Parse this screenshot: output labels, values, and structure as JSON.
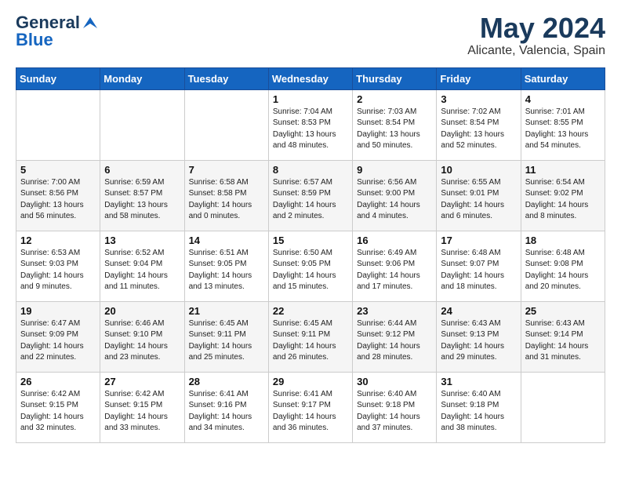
{
  "logo": {
    "line1": "General",
    "line2": "Blue",
    "bird_symbol": "▲"
  },
  "header": {
    "month_title": "May 2024",
    "location": "Alicante, Valencia, Spain"
  },
  "weekdays": [
    "Sunday",
    "Monday",
    "Tuesday",
    "Wednesday",
    "Thursday",
    "Friday",
    "Saturday"
  ],
  "weeks": [
    [
      {
        "day": "",
        "info": ""
      },
      {
        "day": "",
        "info": ""
      },
      {
        "day": "",
        "info": ""
      },
      {
        "day": "1",
        "info": "Sunrise: 7:04 AM\nSunset: 8:53 PM\nDaylight: 13 hours\nand 48 minutes."
      },
      {
        "day": "2",
        "info": "Sunrise: 7:03 AM\nSunset: 8:54 PM\nDaylight: 13 hours\nand 50 minutes."
      },
      {
        "day": "3",
        "info": "Sunrise: 7:02 AM\nSunset: 8:54 PM\nDaylight: 13 hours\nand 52 minutes."
      },
      {
        "day": "4",
        "info": "Sunrise: 7:01 AM\nSunset: 8:55 PM\nDaylight: 13 hours\nand 54 minutes."
      }
    ],
    [
      {
        "day": "5",
        "info": "Sunrise: 7:00 AM\nSunset: 8:56 PM\nDaylight: 13 hours\nand 56 minutes."
      },
      {
        "day": "6",
        "info": "Sunrise: 6:59 AM\nSunset: 8:57 PM\nDaylight: 13 hours\nand 58 minutes."
      },
      {
        "day": "7",
        "info": "Sunrise: 6:58 AM\nSunset: 8:58 PM\nDaylight: 14 hours\nand 0 minutes."
      },
      {
        "day": "8",
        "info": "Sunrise: 6:57 AM\nSunset: 8:59 PM\nDaylight: 14 hours\nand 2 minutes."
      },
      {
        "day": "9",
        "info": "Sunrise: 6:56 AM\nSunset: 9:00 PM\nDaylight: 14 hours\nand 4 minutes."
      },
      {
        "day": "10",
        "info": "Sunrise: 6:55 AM\nSunset: 9:01 PM\nDaylight: 14 hours\nand 6 minutes."
      },
      {
        "day": "11",
        "info": "Sunrise: 6:54 AM\nSunset: 9:02 PM\nDaylight: 14 hours\nand 8 minutes."
      }
    ],
    [
      {
        "day": "12",
        "info": "Sunrise: 6:53 AM\nSunset: 9:03 PM\nDaylight: 14 hours\nand 9 minutes."
      },
      {
        "day": "13",
        "info": "Sunrise: 6:52 AM\nSunset: 9:04 PM\nDaylight: 14 hours\nand 11 minutes."
      },
      {
        "day": "14",
        "info": "Sunrise: 6:51 AM\nSunset: 9:05 PM\nDaylight: 14 hours\nand 13 minutes."
      },
      {
        "day": "15",
        "info": "Sunrise: 6:50 AM\nSunset: 9:05 PM\nDaylight: 14 hours\nand 15 minutes."
      },
      {
        "day": "16",
        "info": "Sunrise: 6:49 AM\nSunset: 9:06 PM\nDaylight: 14 hours\nand 17 minutes."
      },
      {
        "day": "17",
        "info": "Sunrise: 6:48 AM\nSunset: 9:07 PM\nDaylight: 14 hours\nand 18 minutes."
      },
      {
        "day": "18",
        "info": "Sunrise: 6:48 AM\nSunset: 9:08 PM\nDaylight: 14 hours\nand 20 minutes."
      }
    ],
    [
      {
        "day": "19",
        "info": "Sunrise: 6:47 AM\nSunset: 9:09 PM\nDaylight: 14 hours\nand 22 minutes."
      },
      {
        "day": "20",
        "info": "Sunrise: 6:46 AM\nSunset: 9:10 PM\nDaylight: 14 hours\nand 23 minutes."
      },
      {
        "day": "21",
        "info": "Sunrise: 6:45 AM\nSunset: 9:11 PM\nDaylight: 14 hours\nand 25 minutes."
      },
      {
        "day": "22",
        "info": "Sunrise: 6:45 AM\nSunset: 9:11 PM\nDaylight: 14 hours\nand 26 minutes."
      },
      {
        "day": "23",
        "info": "Sunrise: 6:44 AM\nSunset: 9:12 PM\nDaylight: 14 hours\nand 28 minutes."
      },
      {
        "day": "24",
        "info": "Sunrise: 6:43 AM\nSunset: 9:13 PM\nDaylight: 14 hours\nand 29 minutes."
      },
      {
        "day": "25",
        "info": "Sunrise: 6:43 AM\nSunset: 9:14 PM\nDaylight: 14 hours\nand 31 minutes."
      }
    ],
    [
      {
        "day": "26",
        "info": "Sunrise: 6:42 AM\nSunset: 9:15 PM\nDaylight: 14 hours\nand 32 minutes."
      },
      {
        "day": "27",
        "info": "Sunrise: 6:42 AM\nSunset: 9:15 PM\nDaylight: 14 hours\nand 33 minutes."
      },
      {
        "day": "28",
        "info": "Sunrise: 6:41 AM\nSunset: 9:16 PM\nDaylight: 14 hours\nand 34 minutes."
      },
      {
        "day": "29",
        "info": "Sunrise: 6:41 AM\nSunset: 9:17 PM\nDaylight: 14 hours\nand 36 minutes."
      },
      {
        "day": "30",
        "info": "Sunrise: 6:40 AM\nSunset: 9:18 PM\nDaylight: 14 hours\nand 37 minutes."
      },
      {
        "day": "31",
        "info": "Sunrise: 6:40 AM\nSunset: 9:18 PM\nDaylight: 14 hours\nand 38 minutes."
      },
      {
        "day": "",
        "info": ""
      }
    ]
  ]
}
